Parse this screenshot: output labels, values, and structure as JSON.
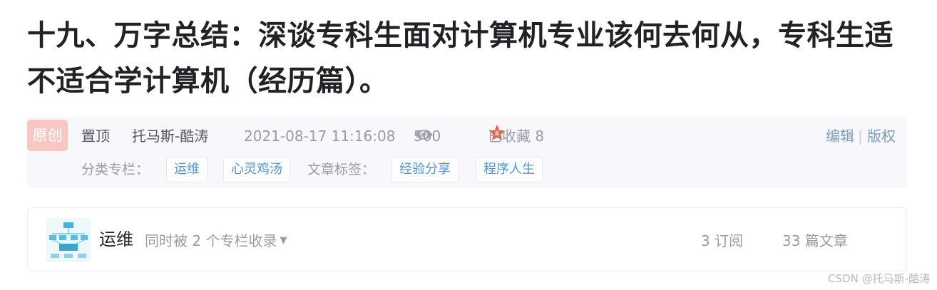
{
  "article": {
    "title": "十九、万字总结：深谈专科生面对计算机专业该何去何从，专科生适不适合学计算机（经历篇）。"
  },
  "meta": {
    "original_badge": "原创",
    "pinned_label": "置顶",
    "author": "托马斯-酷涛",
    "datetime": "2021-08-17 11:16:08",
    "views": "500",
    "favorites": "已收藏 8",
    "edit_label": "编辑",
    "separator": "|",
    "copyright_label": "版权",
    "category_label": "分类专栏：",
    "categories": [
      "运维",
      "心灵鸡汤"
    ],
    "tags_label": "文章标签：",
    "tags": [
      "经验分享",
      "程序人生"
    ]
  },
  "column": {
    "name": "运维",
    "included_text": "同时被 2 个专栏收录",
    "subscriptions": "3 订阅",
    "articles": "33 篇文章"
  },
  "watermark": "CSDN @托马斯-酷涛",
  "colors": {
    "badge_bg": "#f8c7c1",
    "tag_text": "#5094d5",
    "meta_bg": "#f7f7fc",
    "star": "#f55b3b"
  },
  "icons": {
    "views": "eye-icon",
    "favorites": "star-icon",
    "dropdown": "caret-down-icon"
  }
}
